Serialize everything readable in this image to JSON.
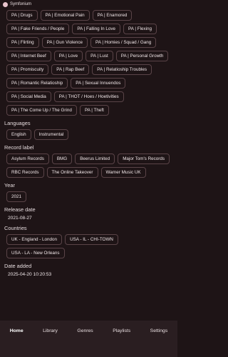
{
  "window": {
    "title": "Symfonium"
  },
  "tags": [
    [
      "PA | Drugs",
      "PA | Emotional Pain",
      "PA | Enamored"
    ],
    [
      "PA | Fake Friends / People",
      "PA | Falling In Love",
      "PA | Flexing"
    ],
    [
      "PA | Flirting",
      "PA | Gun Violence",
      "PA | Homies / Squad / Gang"
    ],
    [
      "PA | Internet Beef",
      "PA | Love",
      "PA | Lust"
    ],
    [
      "PA | Personal Growth",
      "PA | Promiscuity",
      "PA | Rap Beef"
    ],
    [
      "PA | Relatioship Troubles",
      "PA | Romantic Relatioship"
    ],
    [
      "PA | Sexual Innuendos",
      "PA | Social Media"
    ],
    [
      "PA | THOT / Hoes / Hoetivities",
      "PA | The Come Up / The Grind"
    ],
    [
      "PA | Theft"
    ]
  ],
  "languages": {
    "label": "Languages",
    "items": [
      "English",
      "Instrumental"
    ]
  },
  "record_label": {
    "label": "Record label",
    "rows": [
      [
        "Asylum Records",
        "BMG",
        "Beerus Limited"
      ],
      [
        "Major Tom's Records",
        "RBC Records",
        "The Online Takeover"
      ],
      [
        "Warner Music UK"
      ]
    ]
  },
  "year": {
    "label": "Year",
    "value": "2021"
  },
  "release_date": {
    "label": "Release date",
    "value": "2021-08-27"
  },
  "countries": {
    "label": "Countries",
    "rows": [
      [
        "UK - England - London",
        "USA - IL - CHI-TOWN"
      ],
      [
        "USA - LA - New Orleans"
      ]
    ]
  },
  "date_added": {
    "label": "Date added",
    "value": "2025-04-20 10:20:53"
  },
  "nav": {
    "items": [
      "Home",
      "Library",
      "Genres",
      "Playlists",
      "Settings"
    ],
    "active": "Home"
  },
  "colors": {
    "background": "#1e1416",
    "chip_border": "#5a4448",
    "nav_background": "#2a1e21",
    "text": "#f0e6e8"
  }
}
